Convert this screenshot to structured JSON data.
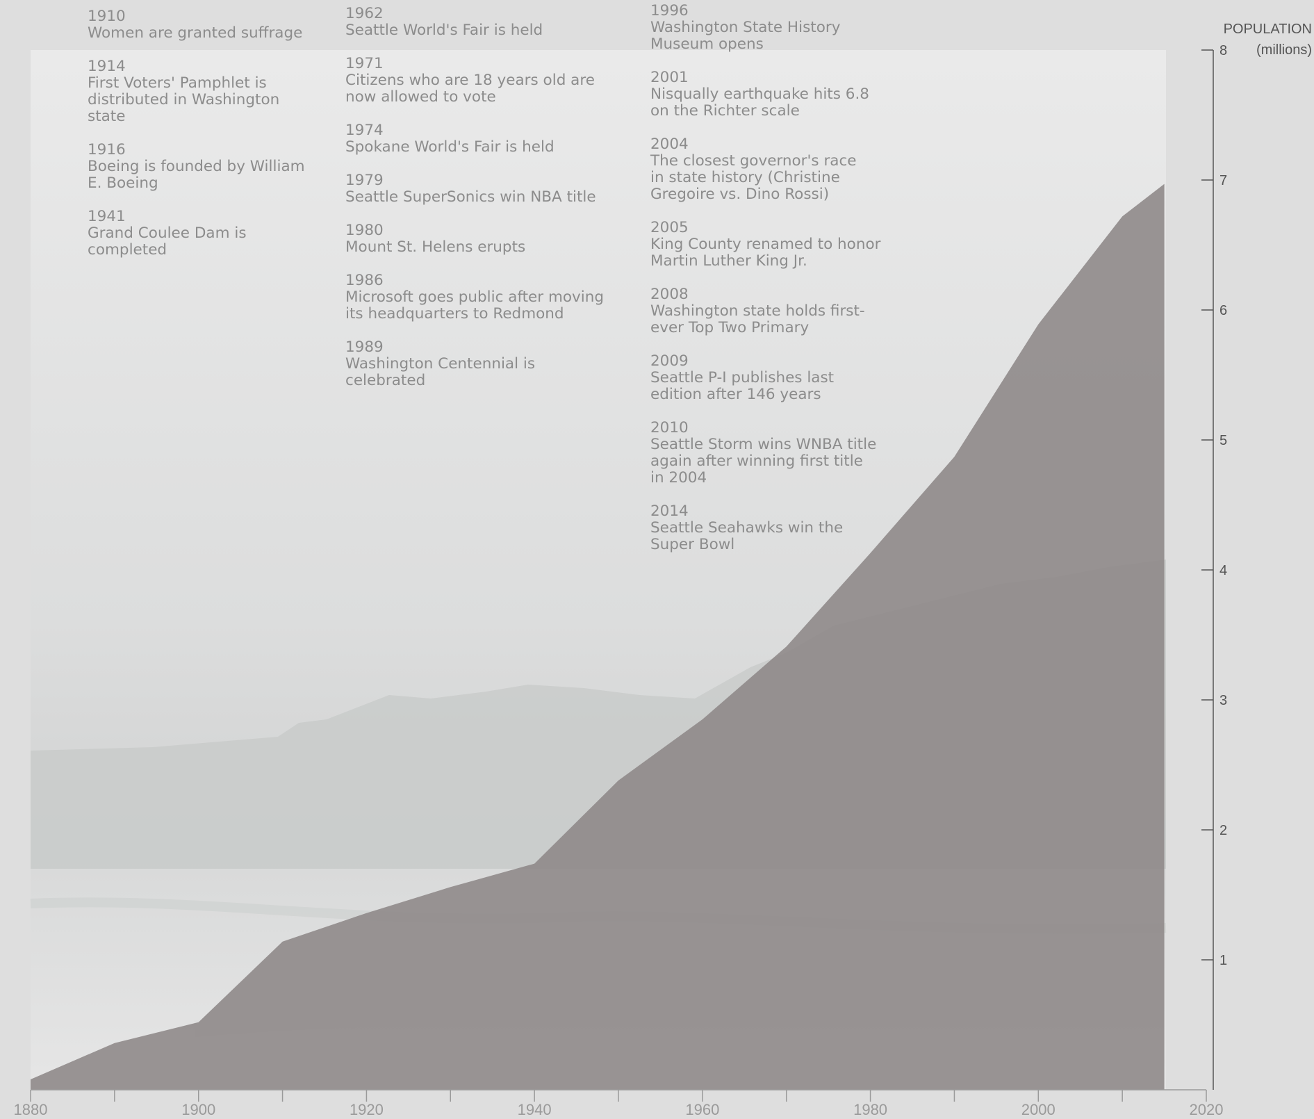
{
  "chart_data": {
    "type": "area",
    "x": [
      1880,
      1890,
      1900,
      1910,
      1920,
      1930,
      1940,
      1950,
      1960,
      1970,
      1980,
      1990,
      2000,
      2010,
      2015
    ],
    "values": [
      0.08,
      0.36,
      0.52,
      1.14,
      1.36,
      1.56,
      1.74,
      2.38,
      2.85,
      3.41,
      4.13,
      4.87,
      5.89,
      6.72,
      6.97
    ],
    "xlim": [
      1880,
      2020
    ],
    "ylim": [
      0,
      8
    ],
    "x_ticks": [
      1880,
      1890,
      1900,
      1910,
      1920,
      1930,
      1940,
      1950,
      1960,
      1970,
      1980,
      1990,
      2000,
      2010,
      2020
    ],
    "x_tick_labels": [
      "1880",
      "1900",
      "1920",
      "1940",
      "1960",
      "1980",
      "2000",
      "2020"
    ],
    "y_tick_labels": [
      "1",
      "2",
      "3",
      "4",
      "5",
      "6",
      "7",
      "8"
    ],
    "ylabel_line1": "POPULATION",
    "ylabel_line2": "(millions)",
    "y_axis_position": "right",
    "grid": false,
    "fill_color": "#8f8989",
    "axis_color": "#555555",
    "background": "misty coastal photograph with evergreen trees and beach"
  },
  "events": {
    "column1": [
      {
        "year": "1910",
        "text": "Women are granted suffrage"
      },
      {
        "year": "1914",
        "text": "First Voters' Pamphlet is\ndistributed in Washington\nstate"
      },
      {
        "year": "1916",
        "text": "Boeing is founded by William\nE. Boeing"
      },
      {
        "year": "1941",
        "text": "Grand Coulee Dam is\ncompleted"
      }
    ],
    "column2": [
      {
        "year": "1962",
        "text": "Seattle World's Fair is held"
      },
      {
        "year": "1971",
        "text": "Citizens who are 18 years old are\nnow allowed to vote"
      },
      {
        "year": "1974",
        "text": "Spokane World's Fair is held"
      },
      {
        "year": "1979",
        "text": "Seattle SuperSonics win NBA title"
      },
      {
        "year": "1980",
        "text": "Mount St. Helens erupts"
      },
      {
        "year": "1986",
        "text": "Microsoft goes public after moving\nits headquarters to Redmond"
      },
      {
        "year": "1989",
        "text": "Washington Centennial is\ncelebrated"
      }
    ],
    "column3": [
      {
        "year": "1996",
        "text": "Washington State History\nMuseum opens"
      },
      {
        "year": "2001",
        "text": "Nisqually earthquake hits 6.8\non the Richter scale"
      },
      {
        "year": "2004",
        "text": "The closest governor's race\nin state history (Christine\nGregoire vs. Dino Rossi)"
      },
      {
        "year": "2005",
        "text": "King County renamed to honor\nMartin Luther King Jr."
      },
      {
        "year": "2008",
        "text": "Washington state holds first-\never Top Two Primary"
      },
      {
        "year": "2009",
        "text": "Seattle P-I publishes last\nedition after 146 years"
      },
      {
        "year": "2010",
        "text": "Seattle Storm wins WNBA title\nagain after winning first title\nin 2004"
      },
      {
        "year": "2014",
        "text": "Seattle Seahawks win the\nSuper Bowl"
      }
    ]
  }
}
